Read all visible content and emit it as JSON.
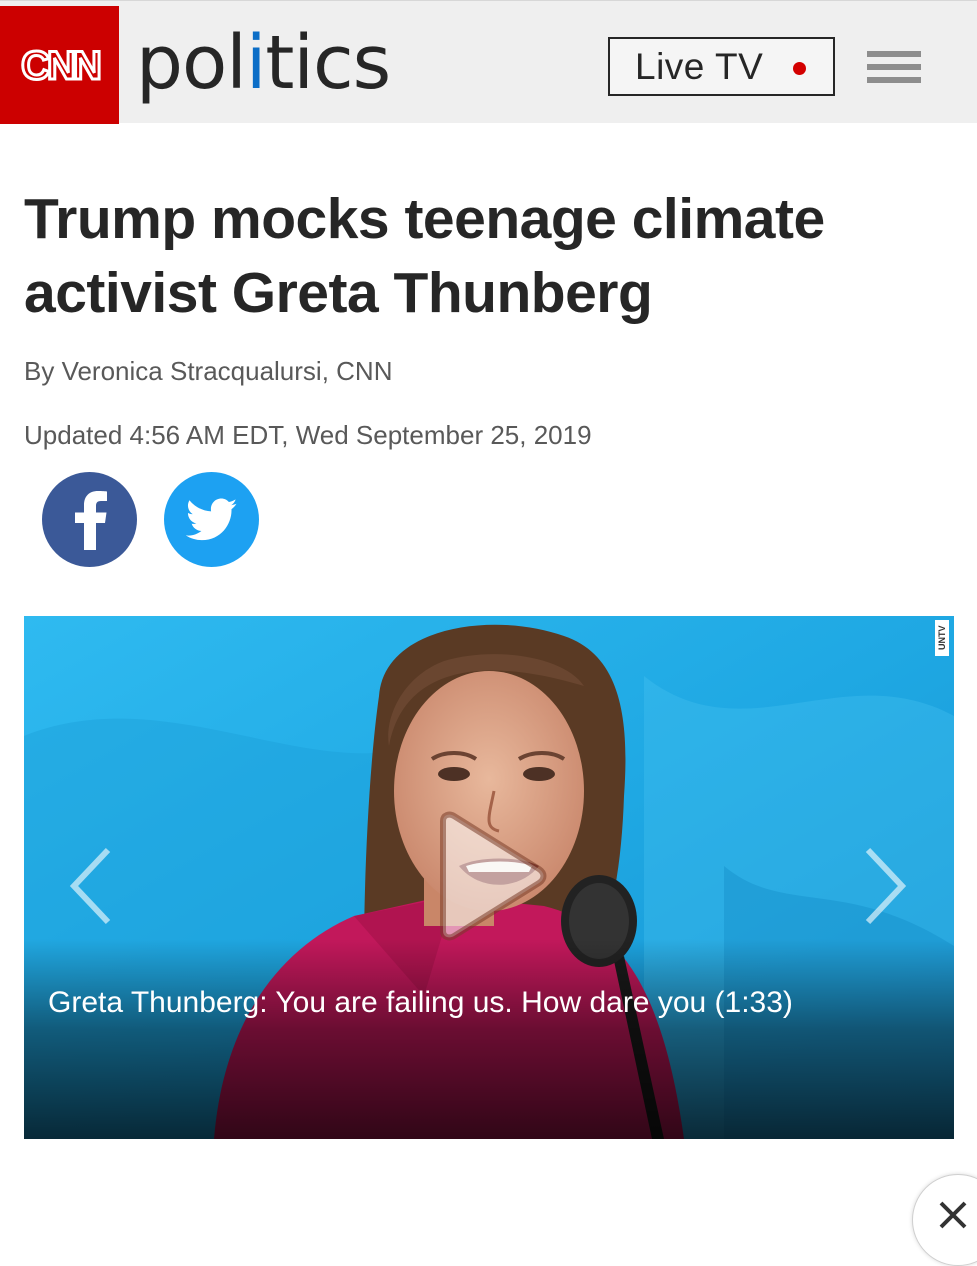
{
  "header": {
    "logo_text": "CNN",
    "section_parts": [
      "pol",
      "i",
      "tics"
    ],
    "live_tv_label": "Live TV"
  },
  "article": {
    "headline": "Trump mocks teenage climate activist Greta Thunberg",
    "byline": "By Veronica Stracqualursi, CNN",
    "updated": "Updated 4:56 AM EDT, Wed September 25, 2019"
  },
  "social": {
    "facebook_icon": "facebook-icon",
    "twitter_icon": "twitter-icon"
  },
  "video": {
    "caption": "Greta Thunberg: You are failing us. How dare you (1:33)",
    "watermark": "UNTV"
  },
  "colors": {
    "brand_red": "#cc0000",
    "facebook_blue": "#3b5998",
    "twitter_blue": "#1da1f2",
    "live_dot": "#d30000",
    "politics_i_blue": "#0c6ec7"
  }
}
